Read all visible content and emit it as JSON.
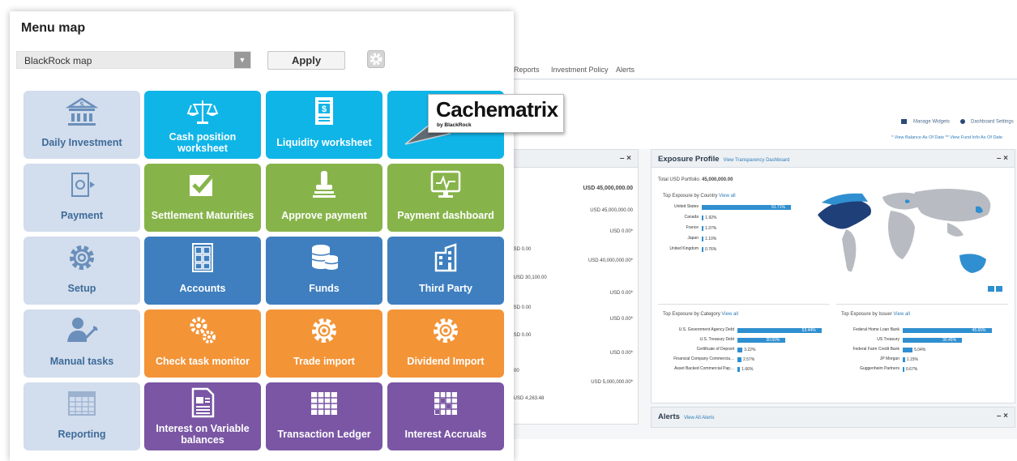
{
  "menu": {
    "title": "Menu map",
    "map_select_value": "BlackRock map",
    "apply_label": "Apply",
    "tiles": [
      {
        "label": "Daily Investment",
        "color": "pale"
      },
      {
        "label": "Cash position worksheet",
        "color": "cyan"
      },
      {
        "label": "Liquidity worksheet",
        "color": "cyan"
      },
      {
        "label": "",
        "color": "cyan"
      },
      {
        "label": "Payment",
        "color": "pale"
      },
      {
        "label": "Settlement Maturities",
        "color": "green"
      },
      {
        "label": "Approve payment",
        "color": "green"
      },
      {
        "label": "Payment dashboard",
        "color": "green"
      },
      {
        "label": "Setup",
        "color": "pale"
      },
      {
        "label": "Accounts",
        "color": "blue"
      },
      {
        "label": "Funds",
        "color": "blue"
      },
      {
        "label": "Third Party",
        "color": "blue"
      },
      {
        "label": "Manual tasks",
        "color": "pale"
      },
      {
        "label": "Check task monitor",
        "color": "orange"
      },
      {
        "label": "Trade import",
        "color": "orange"
      },
      {
        "label": "Dividend Import",
        "color": "orange"
      },
      {
        "label": "Reporting",
        "color": "pale"
      },
      {
        "label": "Interest on Variable balances",
        "color": "purple"
      },
      {
        "label": "Transaction Ledger",
        "color": "purple"
      },
      {
        "label": "Interest Accruals",
        "color": "purple"
      }
    ]
  },
  "callout": {
    "brand": "Cachematrix",
    "sub": "by BlackRock"
  },
  "dashboard": {
    "nav": [
      "Reports",
      "Investment Policy",
      "Alerts"
    ],
    "manage_widgets": "Manage Widgets",
    "dashboard_settings": "Dashboard Settings",
    "note": "* View Balance As Of Date ** View Fund Info As Of Date",
    "left_panel": {
      "close": "– ×",
      "total": "USD 45,000,000.00",
      "values": [
        "USD 45,000,000.00",
        "USD 0.00*",
        "USD 40,000,000.00*",
        "USD 0.00*",
        "USD 0.00*",
        "USD 0.00*",
        "USD 5,000,000.00*"
      ],
      "left_texts": [
        "** USD 0.00",
        "D** USD 30,100.00",
        "** USD 0.00",
        "** USD 0.00",
        "D 0.00",
        "D** USD 4,263.48"
      ]
    },
    "exposure": {
      "title": "Exposure Profile",
      "link": "View Transparency Dashboard",
      "close": "– ×",
      "total_label": "Total USD Portfolio:",
      "total_value": "45,000,000.00",
      "by_country_title": "Top Exposure by Country",
      "view_all": "View all",
      "countries": [
        {
          "name": "United States",
          "pct": 91.71
        },
        {
          "name": "Canada",
          "pct": 1.92
        },
        {
          "name": "France",
          "pct": 1.37
        },
        {
          "name": "Japan",
          "pct": 1.1
        },
        {
          "name": "United Kingdom",
          "pct": 0.76
        }
      ],
      "by_category_title": "Top Exposure by Category",
      "categories": [
        {
          "name": "U.S. Government Agency Debt",
          "pct": 53.44
        },
        {
          "name": "U.S. Treasury Debt",
          "pct": 30.6
        },
        {
          "name": "Certificate of Deposit",
          "pct": 3.22
        },
        {
          "name": "Financial Company Commercia…",
          "pct": 2.57
        },
        {
          "name": "Asset Backed Commercial Pap…",
          "pct": 1.66
        }
      ],
      "by_issuer_title": "Top Exposure by Issuer",
      "issuers": [
        {
          "name": "Federal Home Loan Bank",
          "pct": 45.65
        },
        {
          "name": "US Treasury",
          "pct": 30.45
        },
        {
          "name": "Federal Farm Credit Bank",
          "pct": 5.04
        },
        {
          "name": "JP Morgan",
          "pct": 1.15
        },
        {
          "name": "Guggenheim Partners",
          "pct": 0.67
        }
      ]
    },
    "alerts": {
      "title": "Alerts",
      "link": "View All Alerts",
      "close": "– ×"
    }
  },
  "colors": {
    "pale": "#d2dded",
    "cyan": "#10b5e8",
    "green": "#87b44a",
    "blue": "#3f7fbf",
    "orange": "#f39437",
    "purple": "#7a56a4",
    "bar": "#2f8fd0"
  }
}
